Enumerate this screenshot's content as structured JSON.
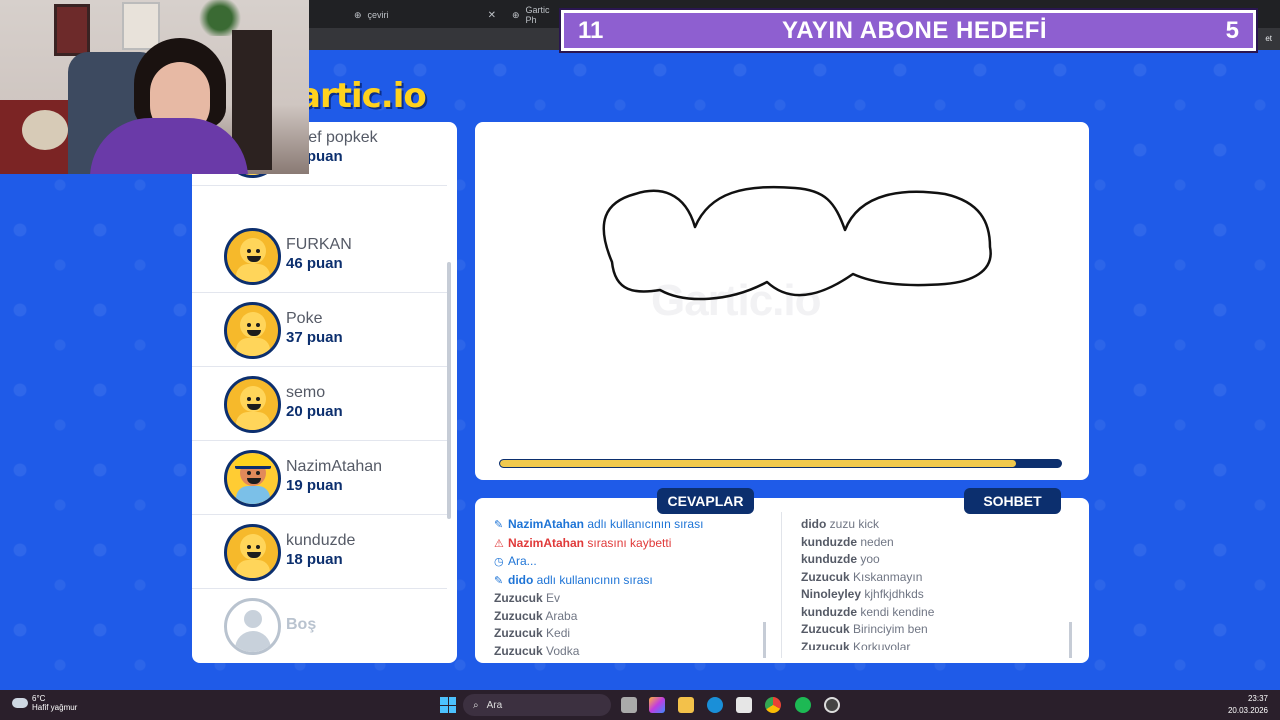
{
  "browser": {
    "tabs": [
      {
        "label": "çeviri"
      },
      {
        "label": "Gartic Ph"
      }
    ],
    "right_text": "et"
  },
  "goal_banner": {
    "current": "11",
    "title": "YAYIN ABONE HEDEFİ",
    "target": "5"
  },
  "game": {
    "logo": "artic.io",
    "watermark": "Gartic.io"
  },
  "players": [
    {
      "name": "eşref popkek",
      "score": "48 puan",
      "avatar": "yellow"
    },
    {
      "name": "FURKAN",
      "score": "46 puan",
      "avatar": "yellow"
    },
    {
      "name": "Poke",
      "score": "37 puan",
      "avatar": "yellow"
    },
    {
      "name": "semo",
      "score": "20 puan",
      "avatar": "yellow"
    },
    {
      "name": "NazimAtahan",
      "score": "19 puan",
      "avatar": "kid"
    },
    {
      "name": "kunduzde",
      "score": "18 puan",
      "avatar": "yellow"
    },
    {
      "name": "Boş",
      "score": "",
      "avatar": "empty"
    }
  ],
  "timer_progress": 0.92,
  "answers_tab": {
    "label": "CEVAPLAR",
    "messages": [
      {
        "type": "blue",
        "icon": "pencil-icon",
        "user": "NazimAtahan",
        "text": "adlı kullanıcının sırası"
      },
      {
        "type": "red",
        "icon": "warning-icon",
        "user": "NazimAtahan",
        "text": "sırasını kaybetti"
      },
      {
        "type": "blue",
        "icon": "clock-icon",
        "user": "",
        "text": "Ara..."
      },
      {
        "type": "blue",
        "icon": "pencil-icon",
        "user": "dido",
        "text": "adlı kullanıcının sırası"
      },
      {
        "type": "normal",
        "icon": "",
        "user": "Zuzucuk",
        "text": "Ev"
      },
      {
        "type": "normal",
        "icon": "",
        "user": "Zuzucuk",
        "text": "Araba"
      },
      {
        "type": "normal",
        "icon": "",
        "user": "Zuzucuk",
        "text": "Kedi"
      },
      {
        "type": "normal",
        "icon": "",
        "user": "Zuzucuk",
        "text": "Vodka"
      }
    ]
  },
  "chat_tab": {
    "label": "SOHBET",
    "messages": [
      {
        "user": "dido",
        "text": "zuzu kick"
      },
      {
        "user": "kunduzde",
        "text": "neden"
      },
      {
        "user": "kunduzde",
        "text": "yoo"
      },
      {
        "user": "Zuzucuk",
        "text": "Kıskanmayın"
      },
      {
        "user": "Ninoleyley",
        "text": "kjhfkjdhkds"
      },
      {
        "user": "kunduzde",
        "text": "kendi kendine"
      },
      {
        "user": "Zuzucuk",
        "text": "Birinciyim ben"
      },
      {
        "user": "Zuzucuk",
        "text": "Korkuyolar"
      }
    ]
  },
  "taskbar": {
    "weather_temp": "6°C",
    "weather_desc": "Hafif yağmur",
    "search_placeholder": "Ara",
    "time": "23:37",
    "date": "20.03.2026"
  }
}
